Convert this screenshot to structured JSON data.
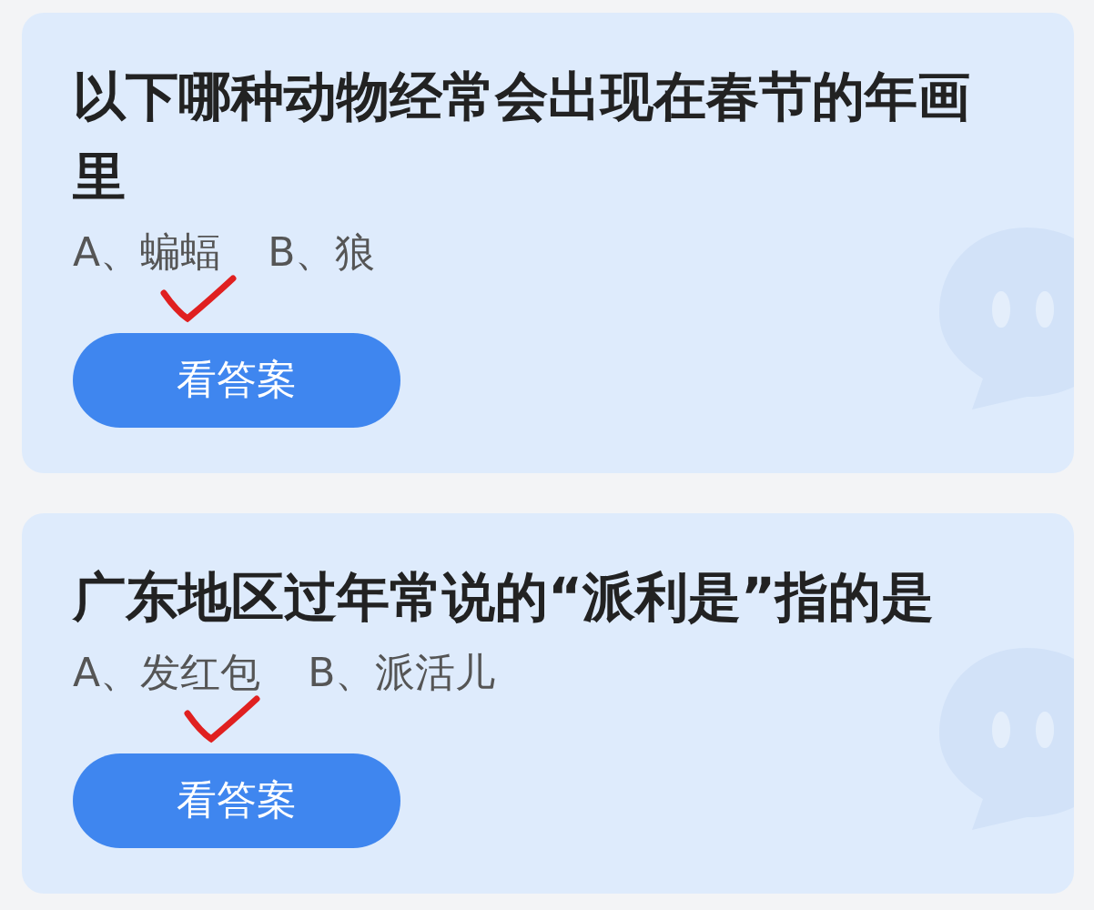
{
  "questions": [
    {
      "title": "以下哪种动物经常会出现在春节的年画里",
      "options": [
        {
          "text": "A、蝙蝠",
          "checked": true
        },
        {
          "text": "B、狼",
          "checked": false
        }
      ],
      "button": "看答案"
    },
    {
      "title": "广东地区过年常说的“派利是”指的是",
      "options": [
        {
          "text": "A、发红包",
          "checked": true
        },
        {
          "text": "B、派活儿",
          "checked": false
        }
      ],
      "button": "看答案"
    }
  ]
}
